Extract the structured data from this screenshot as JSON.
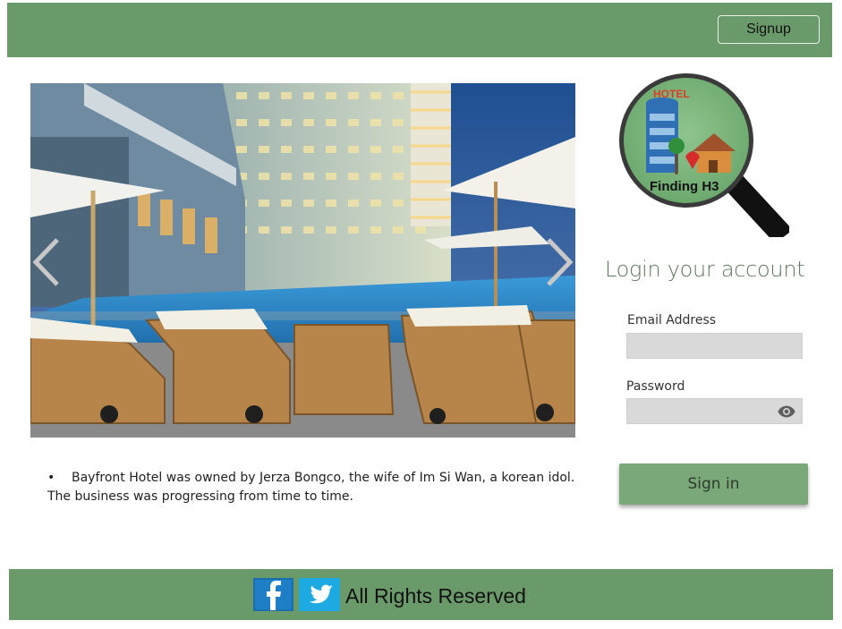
{
  "header": {
    "signup_label": "Signup",
    "color": "#6a9a69"
  },
  "carousel": {
    "prev_icon": "chevron-left-icon",
    "next_icon": "chevron-right-icon",
    "image": "hotel-pool-with-lounge-chairs-and-umbrellas"
  },
  "description": {
    "bullet": "•",
    "text": "Bayfront Hotel was owned by Jerza Bongco, the wife of Im Si Wan, a korean idol.",
    "text2": "The business was progressing from time to time."
  },
  "logo": {
    "badge_text": "HOTEL",
    "caption": "Finding H3"
  },
  "login": {
    "title": "Login your account",
    "email_label": "Email Address",
    "email_value": "",
    "password_label": "Password",
    "password_value": "",
    "toggle_icon": "eye-icon",
    "signin_label": "Sign in",
    "button_color": "#7aa879"
  },
  "footer": {
    "text": "All Rights Reserved",
    "icons": [
      "facebook-icon",
      "twitter-icon"
    ],
    "color": "#6a9a69"
  }
}
